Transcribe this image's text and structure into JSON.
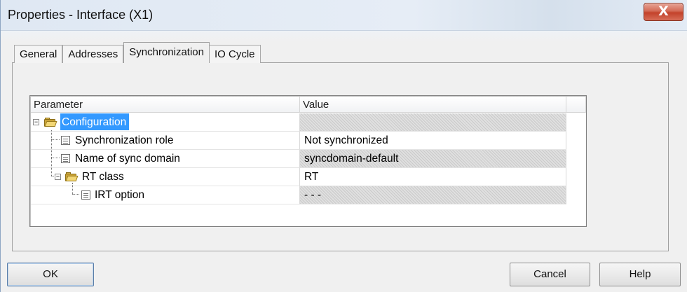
{
  "window": {
    "title": "Properties - Interface (X1)",
    "close_label": "X"
  },
  "tabs": [
    {
      "label": "General"
    },
    {
      "label": "Addresses"
    },
    {
      "label": "Synchronization",
      "active": true
    },
    {
      "label": "IO Cycle"
    }
  ],
  "grid": {
    "columns": [
      "Parameter",
      "Value"
    ],
    "rows": [
      {
        "label": "Configuration",
        "value": "",
        "kind": "folder",
        "expanded": true,
        "selected": true,
        "readonly": true
      },
      {
        "label": "Synchronization role",
        "value": "Not synchronized",
        "kind": "item",
        "readonly": false
      },
      {
        "label": "Name of sync domain",
        "value": "syncdomain-default",
        "kind": "item",
        "readonly": true
      },
      {
        "label": "RT class",
        "value": "RT",
        "kind": "folder",
        "expanded": true,
        "readonly": false
      },
      {
        "label": "IRT option",
        "value": "- - -",
        "kind": "item",
        "readonly": true
      }
    ]
  },
  "buttons": {
    "ok": "OK",
    "cancel": "Cancel",
    "help": "Help"
  },
  "colors": {
    "selection": "#3399ff",
    "close_button": "#c3422a"
  }
}
